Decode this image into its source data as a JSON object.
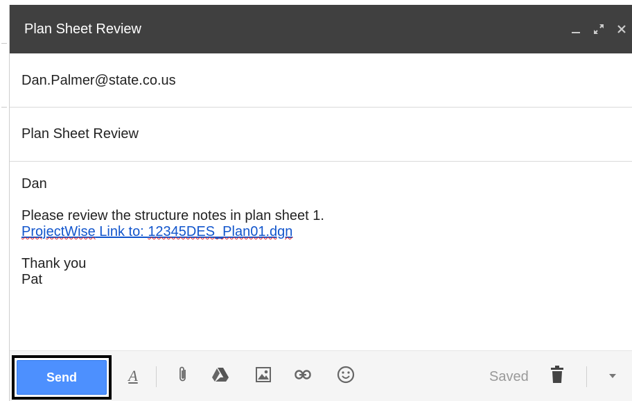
{
  "window": {
    "title": "Plan Sheet Review",
    "controls": [
      "minimize-icon",
      "expand-icon",
      "close-icon"
    ]
  },
  "compose": {
    "to": "Dan.Palmer@state.co.us",
    "subject": "Plan Sheet Review",
    "body": {
      "greeting": "Dan",
      "line1": "Please review the structure notes in plan sheet 1.",
      "link_part1": "ProjectWise",
      "link_part2": " Link to: ",
      "link_part3": "12345DES_Plan01.dgn",
      "closing": "Thank you",
      "signature": "Pat"
    }
  },
  "toolbar": {
    "send_label": "Send",
    "format_label": "A",
    "saved_label": "Saved",
    "icons": [
      "formatting-icon",
      "attach-icon",
      "drive-icon",
      "photo-icon",
      "link-icon",
      "emoji-icon",
      "trash-icon",
      "more-options-icon"
    ]
  },
  "colors": {
    "titlebar": "#404040",
    "send_button": "#4d90fe",
    "link": "#1155cc",
    "spellcheck": "#e0242b"
  }
}
